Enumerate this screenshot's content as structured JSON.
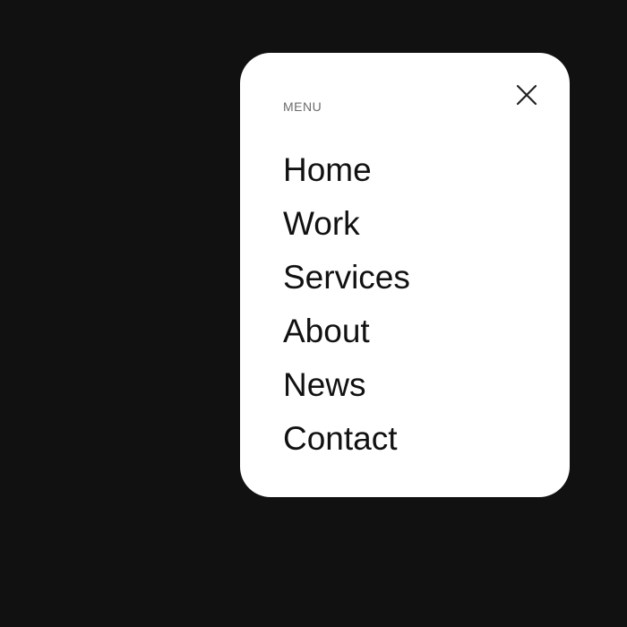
{
  "menu": {
    "label": "MENU",
    "close_icon": "close-icon",
    "items": [
      {
        "label": "Home"
      },
      {
        "label": "Work"
      },
      {
        "label": "Services"
      },
      {
        "label": "About"
      },
      {
        "label": "News"
      },
      {
        "label": "Contact"
      }
    ]
  },
  "colors": {
    "background": "#111111",
    "panel": "#ffffff",
    "text": "#111111",
    "muted": "#6b6b6b"
  }
}
